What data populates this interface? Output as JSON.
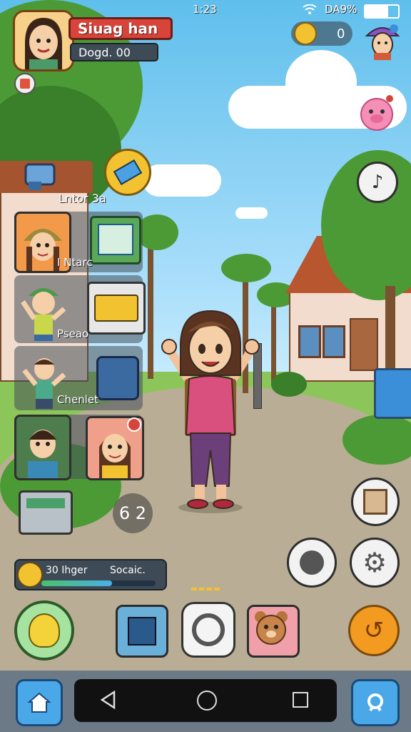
{
  "status_bar": {
    "time": "1:23",
    "battery": "DA9%"
  },
  "profile": {
    "name": "Siuag han",
    "sub": "Dogd. 00"
  },
  "currency": {
    "count": "0"
  },
  "left_panel": {
    "label_top": "Lntor 3a",
    "items": [
      {
        "label": "I Ntarc"
      },
      {
        "label": "Pseao"
      },
      {
        "label": "Chenlet"
      }
    ]
  },
  "hud_small": {
    "timer": "6 2"
  },
  "hunger": {
    "label": "30 Ihger",
    "social": "Socaic.",
    "level": 0.62
  },
  "colors": {
    "accent_red": "#d9443a",
    "accent_blue": "#3aa0e0",
    "accent_yellow": "#f3c230"
  },
  "icons": [
    "home-icon",
    "search-icon",
    "back-icon",
    "circle-home-icon",
    "square-recent-icon",
    "gear-icon",
    "music-icon"
  ]
}
